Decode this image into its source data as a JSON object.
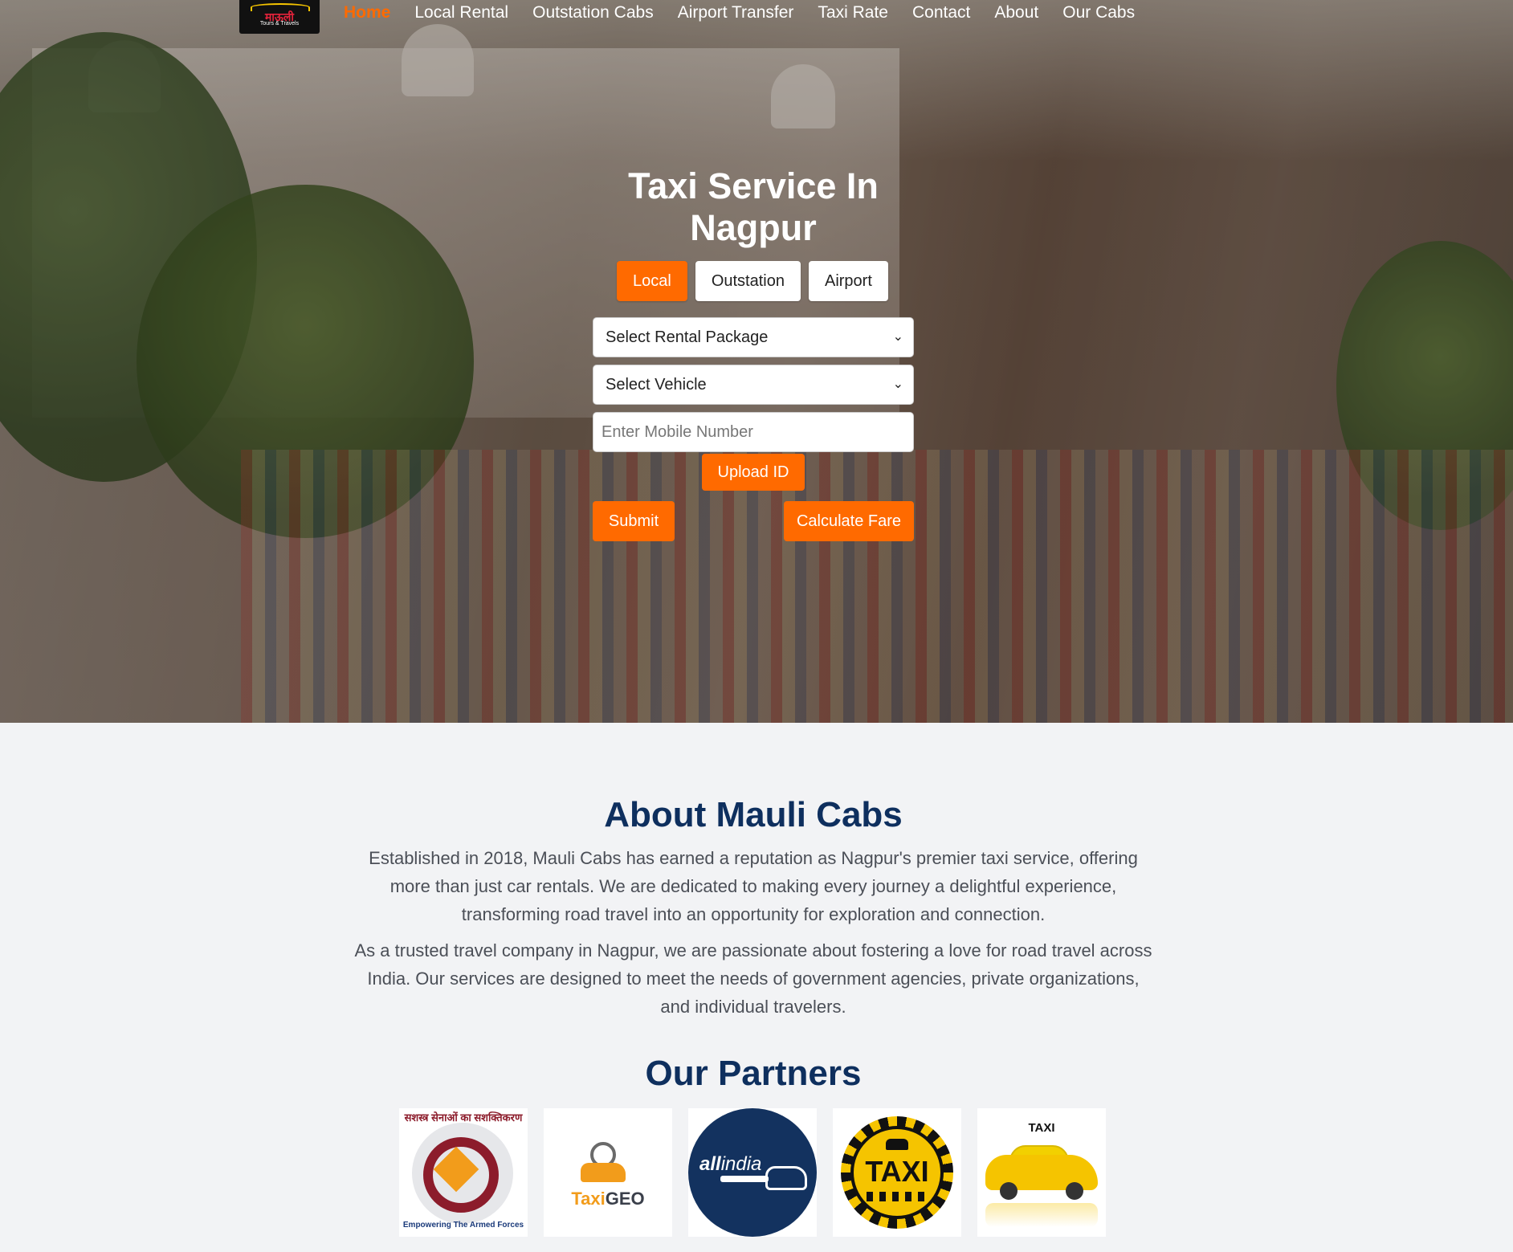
{
  "nav": {
    "logo_text": "माऊली",
    "logo_sub": "Tours & Travels",
    "items": [
      "Home",
      "Local Rental",
      "Outstation Cabs",
      "Airport Transfer",
      "Taxi Rate",
      "Contact",
      "About",
      "Our Cabs"
    ]
  },
  "hero": {
    "title_line1": "Taxi Service In",
    "title_line2": "Nagpur",
    "tabs": [
      "Local",
      "Outstation",
      "Airport"
    ],
    "active_tab": "Local",
    "rental_package": "Select Rental Package",
    "vehicle": "Select Vehicle",
    "mobile_placeholder": "Enter Mobile Number",
    "upload_label": "Upload ID",
    "submit_label": "Submit",
    "fare_label": "Calculate Fare"
  },
  "about": {
    "title": "About Mauli Cabs",
    "p1_l1": "Established in 2018, Mauli Cabs has earned a reputation as Nagpur's premier taxi service, offering",
    "p1_l2": "more than just car rentals. We are dedicated to making every journey a delightful experience,",
    "p1_l3": "transforming road travel into an opportunity for exploration and connection.",
    "p2_l1": "As a trusted travel company in Nagpur, we are passionate about fostering a love for road travel across",
    "p2_l2": "India. Our services are designed to meet the needs of government agencies, private organizations,",
    "p2_l3": "and individual travelers."
  },
  "partners": {
    "title": "Our Partners",
    "p1_top": "सशस्त्र सेनाओं का सशक्तिकरण",
    "p1_bottom": "Empowering The Armed Forces",
    "p2_a": "Taxi",
    "p2_b": "GEO",
    "p3_a": "all",
    "p3_b": "india",
    "p4": "TAXI",
    "p5": "TAXI"
  },
  "colors": {
    "accent": "#ff6a00",
    "heading": "#0e2f5e",
    "body_text": "#4b4f57",
    "page_bg": "#f2f3f5"
  },
  "icons": [
    "chevron-down-icon"
  ]
}
